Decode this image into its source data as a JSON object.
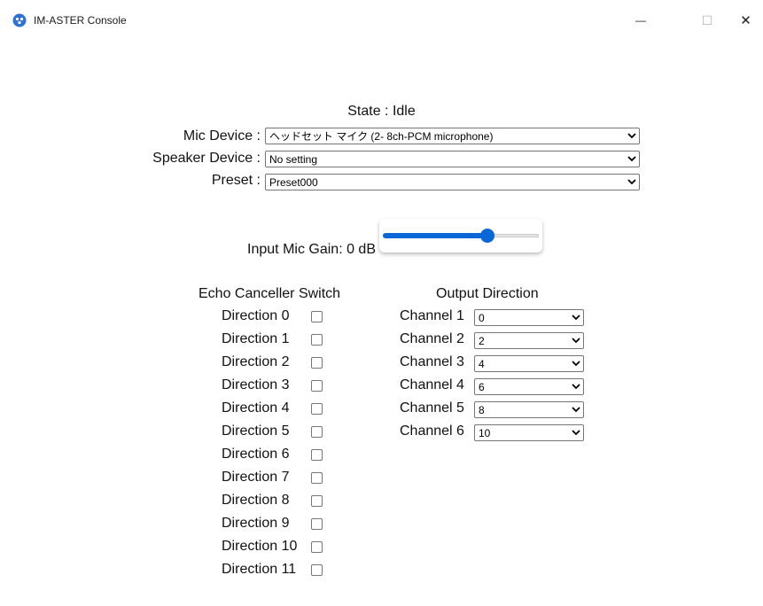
{
  "window": {
    "title": "IM-ASTER Console",
    "minimize_glyph": "—",
    "maximize_glyph": "☐",
    "close_glyph": "✕"
  },
  "state": {
    "text": "State : Idle"
  },
  "devices": {
    "mic_label": "Mic Device :",
    "mic_value": "ヘッドセット マイク (2- 8ch-PCM microphone)",
    "speaker_label": "Speaker Device :",
    "speaker_value": "No setting",
    "preset_label": "Preset :",
    "preset_value": "Preset000"
  },
  "gain": {
    "label": "Input Mic Gain: 0 dB",
    "slider_fraction": 0.67
  },
  "echo": {
    "header": "Echo Canceller Switch",
    "directions": [
      {
        "label": "Direction 0",
        "checked": false
      },
      {
        "label": "Direction 1",
        "checked": false
      },
      {
        "label": "Direction 2",
        "checked": false
      },
      {
        "label": "Direction 3",
        "checked": false
      },
      {
        "label": "Direction 4",
        "checked": false
      },
      {
        "label": "Direction 5",
        "checked": false
      },
      {
        "label": "Direction 6",
        "checked": false
      },
      {
        "label": "Direction 7",
        "checked": false
      },
      {
        "label": "Direction 8",
        "checked": false
      },
      {
        "label": "Direction 9",
        "checked": false
      },
      {
        "label": "Direction 10",
        "checked": false
      },
      {
        "label": "Direction 11",
        "checked": false
      }
    ]
  },
  "output": {
    "header": "Output Direction",
    "channels": [
      {
        "label": "Channel 1",
        "value": "0"
      },
      {
        "label": "Channel 2",
        "value": "2"
      },
      {
        "label": "Channel 3",
        "value": "4"
      },
      {
        "label": "Channel 4",
        "value": "6"
      },
      {
        "label": "Channel 5",
        "value": "8"
      },
      {
        "label": "Channel 6",
        "value": "10"
      }
    ]
  },
  "colors": {
    "accent": "#0a67d8",
    "border": "#767676",
    "background": "#ffffff"
  }
}
